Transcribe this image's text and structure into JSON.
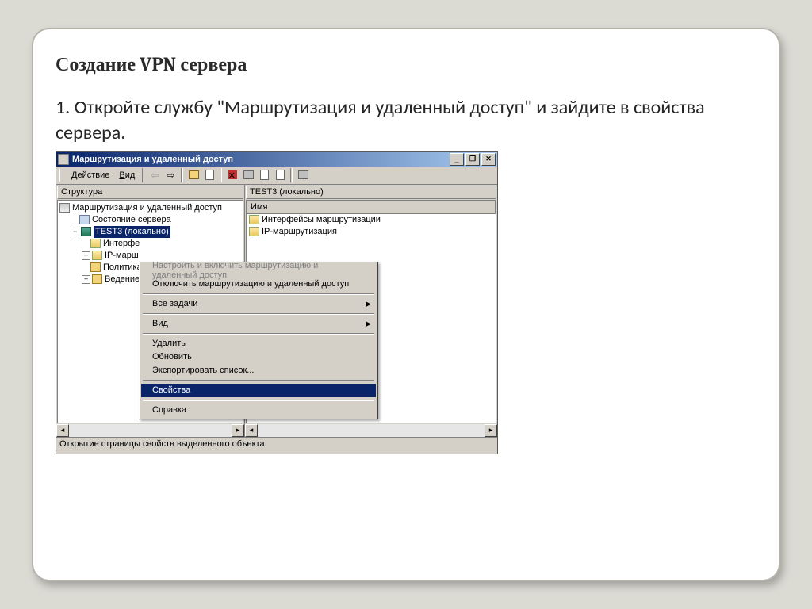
{
  "slide": {
    "title": "Создание VPN сервера",
    "step_text": "1. Откройте службу \"Маршрутизация и удаленный доступ\" и зайдите в свойства сервера."
  },
  "mmc": {
    "window_title": "Маршрутизация и удаленный доступ",
    "menu": {
      "action": "Действие",
      "view": "Вид"
    },
    "left": {
      "header": "Структура",
      "root": "Маршрутизация и удаленный доступ",
      "items": [
        "Состояние сервера",
        "TEST3 (локально)",
        "Интерфе",
        "IP-марш",
        "Политика",
        "Ведение"
      ]
    },
    "right": {
      "header": "TEST3 (локально)",
      "col": "Имя",
      "rows": [
        "Интерфейсы маршрутизации",
        "IP-маршрутизация"
      ]
    },
    "status": "Открытие страницы свойств выделенного объекта."
  },
  "ctx": {
    "configure": "Настроить и включить маршрутизацию и удаленный доступ",
    "disable": "Отключить маршрутизацию и удаленный доступ",
    "all_tasks": "Все задачи",
    "view": "Вид",
    "delete": "Удалить",
    "refresh": "Обновить",
    "export": "Экспортировать список...",
    "properties": "Свойства",
    "help": "Справка"
  }
}
